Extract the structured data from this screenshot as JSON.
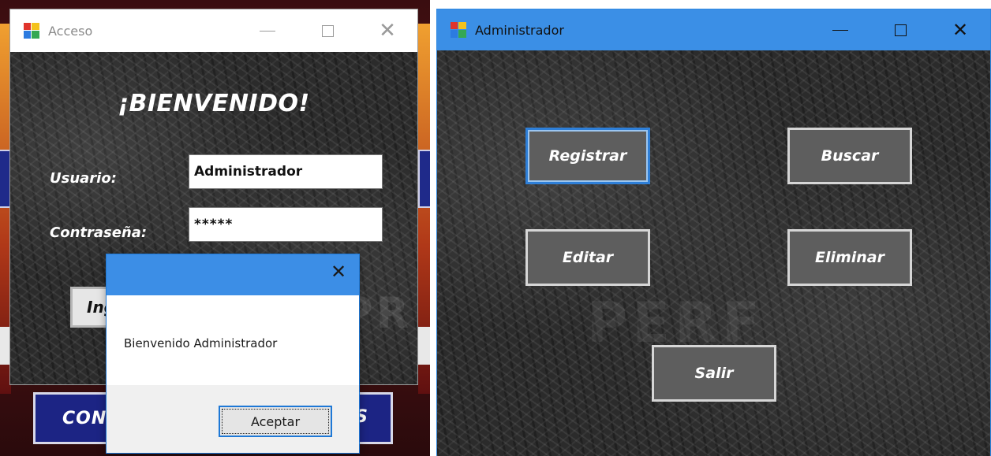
{
  "acceso_window": {
    "title": "Acceso",
    "welcome": "¡BIENVENIDO!",
    "usuario_label": "Usuario:",
    "usuario_value": "Administrador",
    "password_label": "Contraseña:",
    "password_value": "*****",
    "ingresar_label": "Ing"
  },
  "background_app": {
    "connect_button_label": "CON",
    "connect_button_tail": "S"
  },
  "message_box": {
    "message": "Bienvenido Administrador",
    "ok_label": "Aceptar"
  },
  "admin_window": {
    "title": "Administrador",
    "buttons": {
      "registrar": "Registrar",
      "buscar": "Buscar",
      "editar": "Editar",
      "eliminar": "Eliminar",
      "salir": "Salir"
    }
  },
  "colors": {
    "titlebar_active": "#3b8fe6",
    "focus_border": "#2e7fd8",
    "admin_button": "#5e5e5e",
    "connect_button": "#1c2484"
  }
}
